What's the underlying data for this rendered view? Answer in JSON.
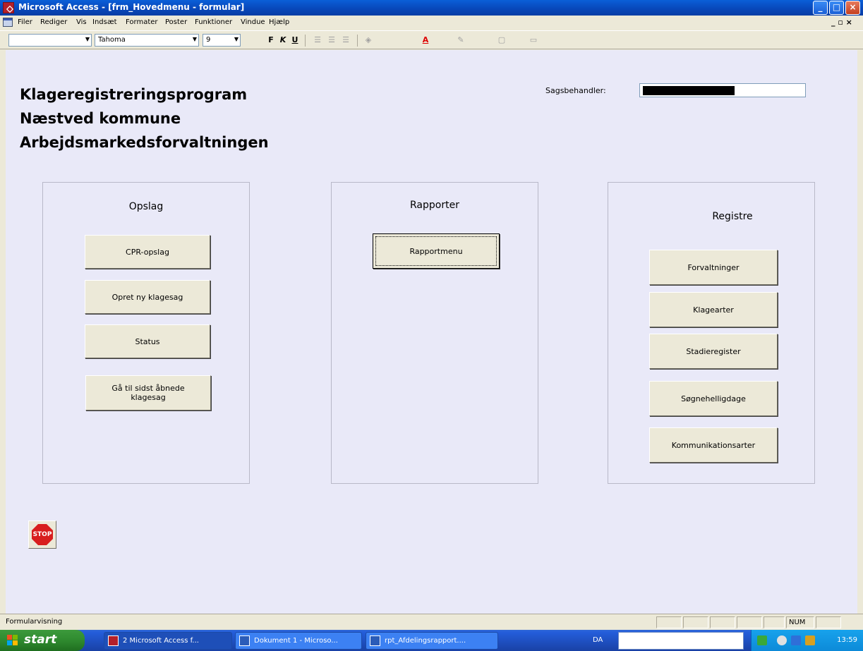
{
  "window": {
    "title": "Microsoft Access - [frm_Hovedmenu - formular]",
    "controls": [
      "_",
      "□",
      "×"
    ]
  },
  "menubar": {
    "items": [
      "Filer",
      "Rediger",
      "Vis",
      "Indsæt",
      "Formater",
      "Poster",
      "Funktioner",
      "Vindue",
      "Hjælp"
    ],
    "mdi_controls": "_ ▫ ×"
  },
  "toolbar": {
    "object_combo": "",
    "font_combo": "Tahoma",
    "size_combo": "9",
    "bold": "F",
    "italic": "K",
    "underline": "U"
  },
  "form": {
    "headings": [
      "Klageregistreringsprogram",
      "Næstved kommune",
      "Arbejdsmarkedsforvaltningen"
    ],
    "sagsbehandler_label": "Sagsbehandler:",
    "panels": {
      "opslag": {
        "title": "Opslag",
        "buttons": [
          "CPR-opslag",
          "Opret ny klagesag",
          "Status",
          "Gå til sidst åbnede klagesag"
        ]
      },
      "rapporter": {
        "title": "Rapporter",
        "buttons": [
          "Rapportmenu"
        ]
      },
      "registre": {
        "title": "Registre",
        "buttons": [
          "Forvaltninger",
          "Klagearter",
          "Stadieregister",
          "Søgnehelligdage",
          "Kommunikationsarter"
        ]
      }
    },
    "stop_label": "STOP"
  },
  "statusbar": {
    "text": "Formularvisning",
    "num": "NUM"
  },
  "taskbar": {
    "start": "start",
    "tasks": [
      "2 Microsoft Access f...",
      "Dokument 1 - Microso...",
      "rpt_Afdelingsrapport...."
    ],
    "language": "DA",
    "clock": "13:59"
  },
  "colors": {
    "form_background": "#e9e9f8",
    "title_bar": "#0846b8",
    "taskbar": "#245edb",
    "start_button": "#2f8a2f",
    "stop_sign": "#d81e1e"
  }
}
